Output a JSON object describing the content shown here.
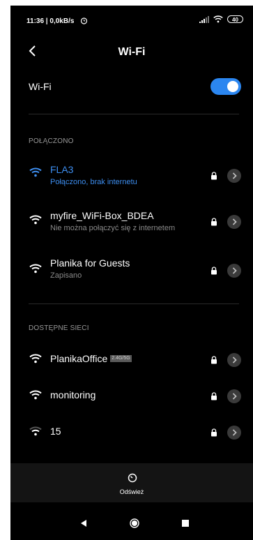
{
  "status_bar": {
    "time_speed": "11:36 | 0,0kB/s",
    "battery": "40"
  },
  "header": {
    "title": "Wi-Fi"
  },
  "wifi_toggle": {
    "label": "Wi-Fi",
    "enabled": true
  },
  "sections": {
    "connected_header": "POŁĄCZONO",
    "available_header": "DOSTĘPNE SIECI"
  },
  "connected_networks": [
    {
      "name": "FLA3",
      "status": "Połączono, brak internetu"
    },
    {
      "name": "myfire_WiFi-Box_BDEA",
      "status": "Nie można połączyć się z internetem"
    },
    {
      "name": "Planika for Guests",
      "status": "Zapisano"
    }
  ],
  "available_networks": [
    {
      "name": "PlanikaOffice",
      "badge": "2.4G/5G"
    },
    {
      "name": "monitoring"
    },
    {
      "name": "15"
    }
  ],
  "bottom_bar": {
    "refresh_label": "Odśwież"
  },
  "colors": {
    "accent": "#2b86f0",
    "connected_text": "#3d8ef0",
    "background": "#000000"
  }
}
